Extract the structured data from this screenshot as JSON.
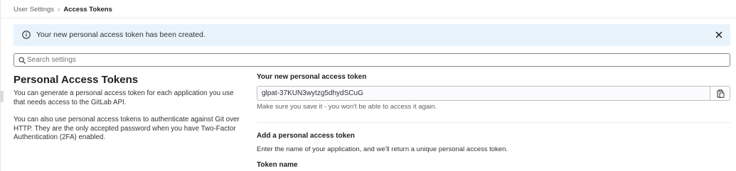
{
  "breadcrumb": {
    "parent": "User Settings",
    "separator": "›",
    "current": "Access Tokens"
  },
  "alert": {
    "message": "Your new personal access token has been created.",
    "icon": "info-circle-icon",
    "close_icon": "close-icon",
    "background": "#e9f3fc"
  },
  "search": {
    "placeholder": "Search settings",
    "value": ""
  },
  "section": {
    "title": "Personal Access Tokens",
    "description_1": "You can generate a personal access token for each application you use that needs access to the GitLab API.",
    "description_2": "You can also use personal access tokens to authenticate against Git over HTTP. They are the only accepted password when you have Two-Factor Authentication (2FA) enabled."
  },
  "new_token": {
    "label": "Your new personal access token",
    "value": "glpat-37KUN3wytzg5dhydSCuG",
    "help": "Make sure you save it - you won't be able to access it again.",
    "copy_icon": "clipboard-icon"
  },
  "add_token": {
    "heading": "Add a personal access token",
    "description": "Enter the name of your application, and we'll return a unique personal access token.",
    "name_label": "Token name"
  }
}
